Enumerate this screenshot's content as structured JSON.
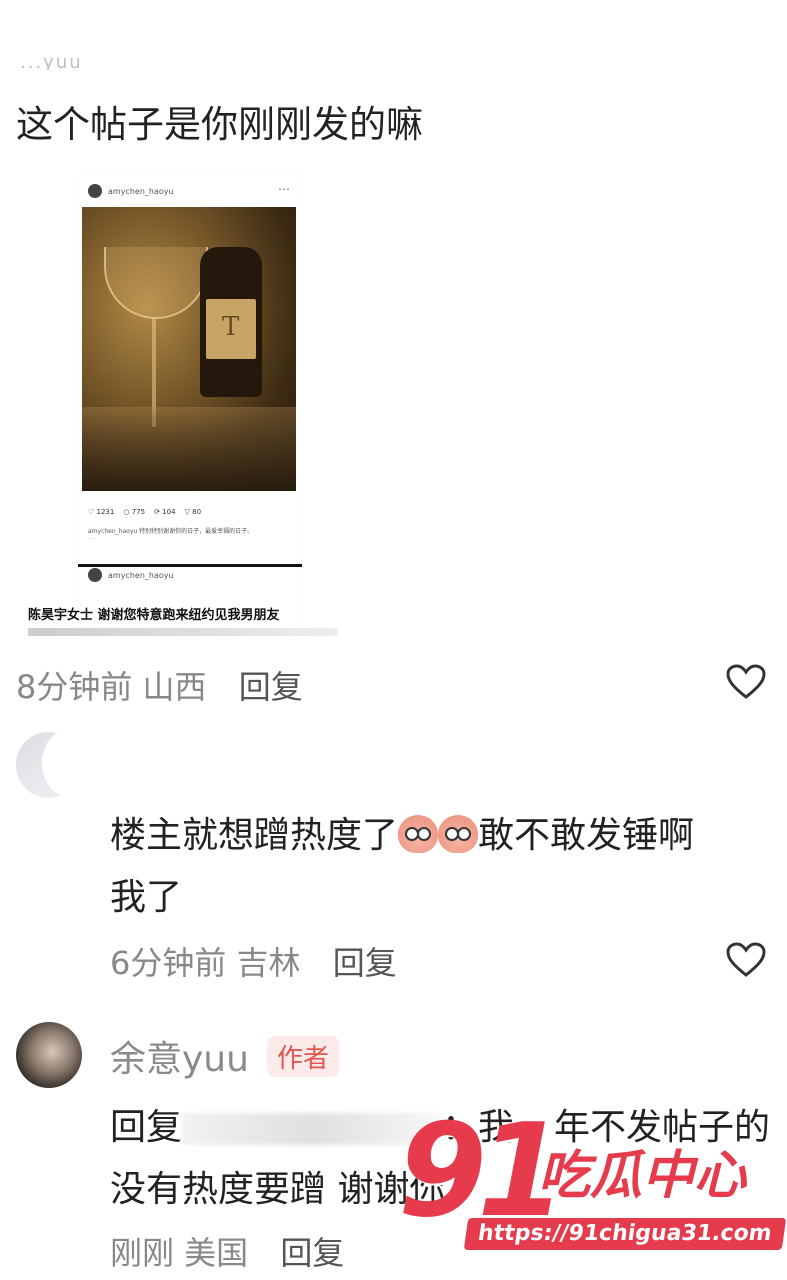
{
  "post": {
    "top_fade": "...yuu",
    "text": "这个帖子是你刚刚发的嘛",
    "meta_time": "8分钟前 山西",
    "reply_label": "回复"
  },
  "screenshot": {
    "handle": "amychen_haoyu",
    "counts": [
      "1231",
      "775",
      "104",
      "80"
    ],
    "caption": "amychen_haoyu 特别特别谢谢你的日子，最爱幸福的日子。",
    "handle2": "amychen_haoyu",
    "big_text": "陈昊宇女士 谢谢您特意跑来纽约见我男朋友",
    "label_mark": "T"
  },
  "comment1": {
    "text_before": "楼主就想蹭热度了",
    "text_after": "敢不敢发锤啊",
    "text_line2": "我了",
    "meta_time": "6分钟前 吉林",
    "reply_label": "回复"
  },
  "comment2": {
    "username": "余意yuu",
    "badge": "作者",
    "line1_prefix": "回复",
    "line1_mid": "：我",
    "line1_suffix": "年不发帖子的",
    "line2": "没有热度要蹭 谢谢你",
    "meta_time": "刚刚 美国",
    "reply_label": "回复"
  },
  "watermark": {
    "number": "91",
    "name": "吃瓜中心",
    "url": "https://91chigua31.com"
  },
  "colors": {
    "accent": "#e63a4d",
    "meta": "#888888",
    "badge_bg": "#fdeaea"
  }
}
